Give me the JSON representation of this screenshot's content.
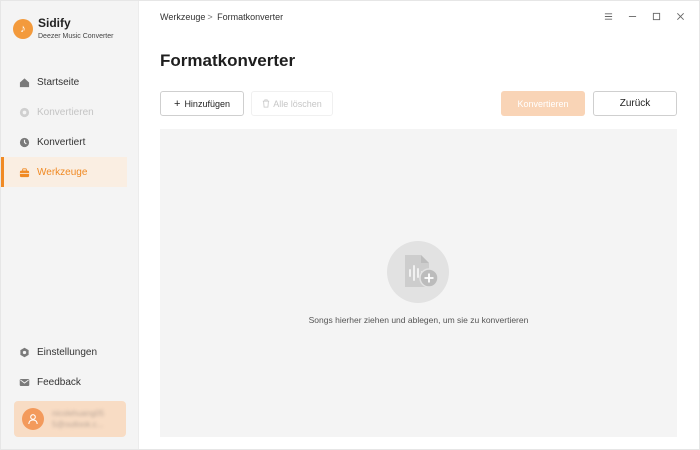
{
  "brand": {
    "name": "Sidify",
    "subtitle": "Deezer Music Converter",
    "logo_glyph": "♪",
    "accent": "#f08a24"
  },
  "sidebar": {
    "items": [
      {
        "label": "Startseite",
        "icon": "home-icon",
        "state": "normal"
      },
      {
        "label": "Konvertieren",
        "icon": "convert-icon",
        "state": "disabled"
      },
      {
        "label": "Konvertiert",
        "icon": "clock-icon",
        "state": "normal"
      },
      {
        "label": "Werkzeuge",
        "icon": "toolbox-icon",
        "state": "active"
      }
    ],
    "bottom_items": [
      {
        "label": "Einstellungen",
        "icon": "gear-icon"
      },
      {
        "label": "Feedback",
        "icon": "mail-icon"
      }
    ],
    "user": {
      "line1": "nicolehuang05",
      "line2": "5@outlook.c..."
    }
  },
  "header": {
    "breadcrumb_parent": "Werkzeuge",
    "breadcrumb_sep": ">",
    "breadcrumb_current": "Formatkonverter"
  },
  "main": {
    "title": "Formatkonverter",
    "add_label": "Hinzufügen",
    "clear_label": "Alle löschen",
    "convert_label": "Konvertieren",
    "back_label": "Zurück",
    "drop_text": "Songs hierher ziehen und ablegen, um sie zu konvertieren"
  }
}
